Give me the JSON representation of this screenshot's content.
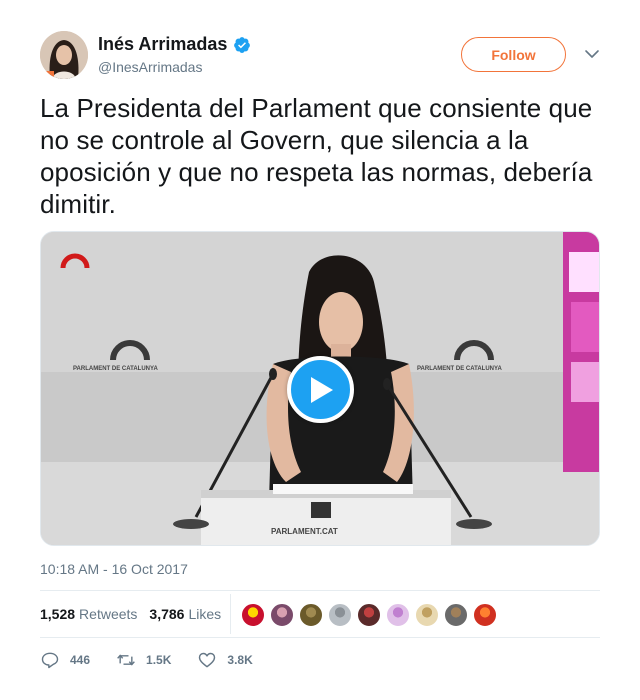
{
  "user": {
    "display_name": "Inés Arrimadas",
    "handle": "@InesArrimadas",
    "verified_icon": "verified-badge-icon"
  },
  "header": {
    "follow_label": "Follow",
    "accent_color": "#f2743a"
  },
  "tweet": {
    "text": "La Presidenta del Parlament que consiente que no se controle al Govern, que silencia a la oposición y que no respeta las normas, debería dimitir.",
    "timestamp": "10:18 AM - 16 Oct 2017"
  },
  "media": {
    "type": "video",
    "play_icon": "play-icon",
    "podium_text": "PARLAMENT.CAT",
    "backdrop_left_text": "PARLAMENT DE CATALUNYA",
    "backdrop_right_text": "PARLAMENT DE CATALUNYA"
  },
  "stats": {
    "retweets_count": "1,528",
    "retweets_label": "Retweets",
    "likes_count": "3,786",
    "likes_label": "Likes"
  },
  "likers": [
    {
      "color": "#c8102e",
      "accent": "#ffd700"
    },
    {
      "color": "#7a4a6a",
      "accent": "#d8a0b0"
    },
    {
      "color": "#6b5a2a",
      "accent": "#a08a50"
    },
    {
      "color": "#b8bec4",
      "accent": "#8a9096"
    },
    {
      "color": "#5a2a2a",
      "accent": "#c04040"
    },
    {
      "color": "#e0c0e8",
      "accent": "#c080d0"
    },
    {
      "color": "#e8d8b0",
      "accent": "#c0a060"
    },
    {
      "color": "#6a6a6a",
      "accent": "#a0805a"
    },
    {
      "color": "#d03020",
      "accent": "#ff8030"
    }
  ],
  "actions": {
    "replies": "446",
    "retweets": "1.5K",
    "likes": "3.8K"
  }
}
